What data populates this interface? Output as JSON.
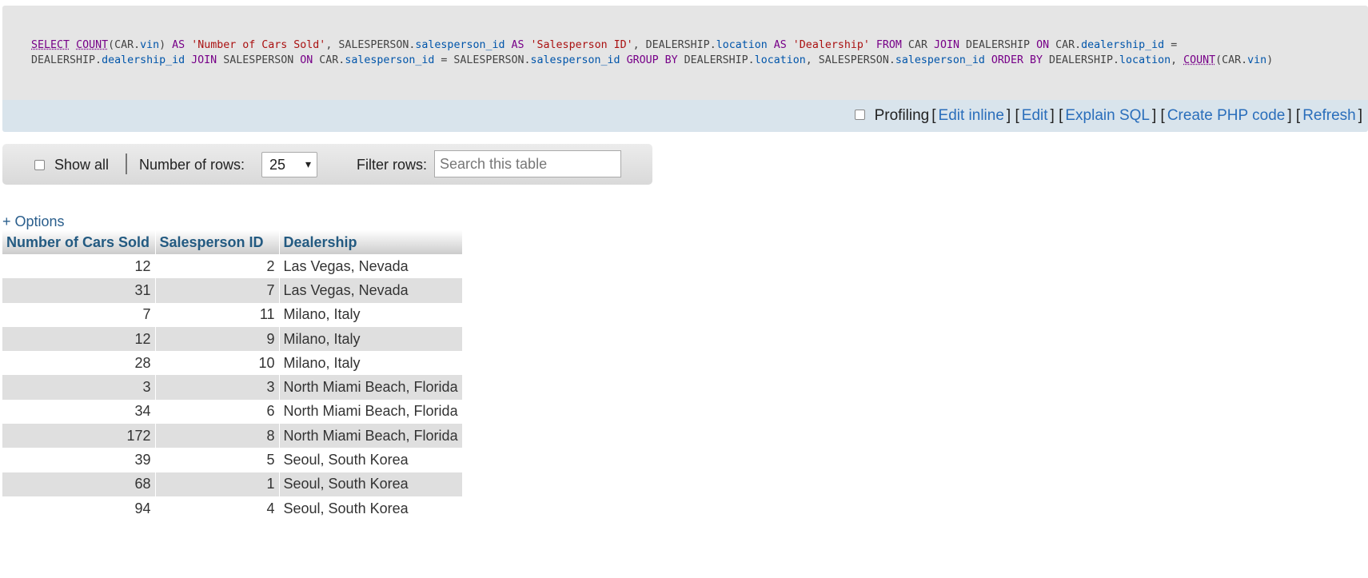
{
  "sql": {
    "tokens": [
      {
        "t": "SELECT",
        "c": "fn"
      },
      {
        "t": " ",
        "c": ""
      },
      {
        "t": "COUNT",
        "c": "fn"
      },
      {
        "t": "(CAR.",
        "c": ""
      },
      {
        "t": "vin",
        "c": "col"
      },
      {
        "t": ") ",
        "c": ""
      },
      {
        "t": "AS",
        "c": "kw"
      },
      {
        "t": " ",
        "c": ""
      },
      {
        "t": "'Number of Cars Sold'",
        "c": "str"
      },
      {
        "t": ", SALESPERSON.",
        "c": ""
      },
      {
        "t": "salesperson_id",
        "c": "col"
      },
      {
        "t": " ",
        "c": ""
      },
      {
        "t": "AS",
        "c": "kw"
      },
      {
        "t": " ",
        "c": ""
      },
      {
        "t": "'Salesperson ID'",
        "c": "str"
      },
      {
        "t": ", DEALERSHIP.",
        "c": ""
      },
      {
        "t": "location",
        "c": "col"
      },
      {
        "t": " ",
        "c": ""
      },
      {
        "t": "AS",
        "c": "kw"
      },
      {
        "t": " ",
        "c": ""
      },
      {
        "t": "'Dealership'",
        "c": "str"
      },
      {
        "t": " ",
        "c": ""
      },
      {
        "t": "FROM",
        "c": "kw"
      },
      {
        "t": " CAR ",
        "c": ""
      },
      {
        "t": "JOIN",
        "c": "kw"
      },
      {
        "t": " DEALERSHIP ",
        "c": ""
      },
      {
        "t": "ON",
        "c": "kw"
      },
      {
        "t": " CAR.",
        "c": ""
      },
      {
        "t": "dealership_id",
        "c": "col"
      },
      {
        "t": " = DEALERSHIP.",
        "c": ""
      },
      {
        "t": "dealership_id",
        "c": "col"
      },
      {
        "t": " ",
        "c": ""
      },
      {
        "t": "JOIN",
        "c": "kw"
      },
      {
        "t": " SALESPERSON ",
        "c": ""
      },
      {
        "t": "ON",
        "c": "kw"
      },
      {
        "t": " CAR.",
        "c": ""
      },
      {
        "t": "salesperson_id",
        "c": "col"
      },
      {
        "t": " = SALESPERSON.",
        "c": ""
      },
      {
        "t": "salesperson_id",
        "c": "col"
      },
      {
        "t": " ",
        "c": ""
      },
      {
        "t": "GROUP BY",
        "c": "kw"
      },
      {
        "t": " DEALERSHIP.",
        "c": ""
      },
      {
        "t": "location",
        "c": "col"
      },
      {
        "t": ", SALESPERSON.",
        "c": ""
      },
      {
        "t": "salesperson_id",
        "c": "col"
      },
      {
        "t": " ",
        "c": ""
      },
      {
        "t": "ORDER BY",
        "c": "kw"
      },
      {
        "t": " DEALERSHIP.",
        "c": ""
      },
      {
        "t": "location",
        "c": "col"
      },
      {
        "t": ", ",
        "c": ""
      },
      {
        "t": "COUNT",
        "c": "fn"
      },
      {
        "t": "(CAR.",
        "c": ""
      },
      {
        "t": "vin",
        "c": "col"
      },
      {
        "t": ")",
        "c": ""
      }
    ]
  },
  "toolbar": {
    "profiling_label": "Profiling",
    "links": [
      "Edit inline",
      "Edit",
      "Explain SQL",
      "Create PHP code",
      "Refresh"
    ]
  },
  "navigation": {
    "show_all_label": "Show all",
    "rows_label": "Number of rows:",
    "rows_value": "25",
    "filter_label": "Filter rows:",
    "search_placeholder": "Search this table"
  },
  "options_label": "+ Options",
  "table": {
    "headers": [
      "Number of Cars Sold",
      "Salesperson ID",
      "Dealership"
    ],
    "rows": [
      [
        "12",
        "2",
        "Las Vegas, Nevada"
      ],
      [
        "31",
        "7",
        "Las Vegas, Nevada"
      ],
      [
        "7",
        "11",
        "Milano, Italy"
      ],
      [
        "12",
        "9",
        "Milano, Italy"
      ],
      [
        "28",
        "10",
        "Milano, Italy"
      ],
      [
        "3",
        "3",
        "North Miami Beach, Florida"
      ],
      [
        "34",
        "6",
        "North Miami Beach, Florida"
      ],
      [
        "172",
        "8",
        "North Miami Beach, Florida"
      ],
      [
        "39",
        "5",
        "Seoul, South Korea"
      ],
      [
        "68",
        "1",
        "Seoul, South Korea"
      ],
      [
        "94",
        "4",
        "Seoul, South Korea"
      ]
    ]
  }
}
